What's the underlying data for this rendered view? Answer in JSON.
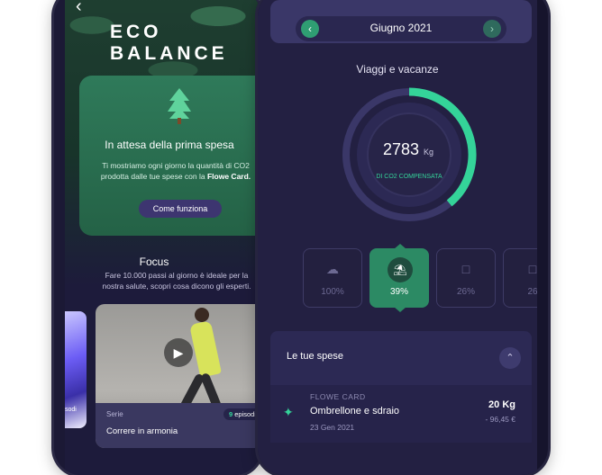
{
  "left_app": {
    "title": "ECO BALANCE",
    "card": {
      "title": "In attesa della prima spesa",
      "desc_prefix": "Ti mostriamo ogni giorno la quantità di CO2 prodotta dalle tue spese con la",
      "desc_bold": "Flowe Card.",
      "button": "Come funziona"
    },
    "focus": {
      "title": "Focus",
      "desc": "Fare 10.000 passi al giorno è ideale per la nostra salute, scopri cosa dicono gli esperti."
    },
    "side_thumb_label": "sodi",
    "video": {
      "series_label": "Serie",
      "episodes_count": "9",
      "episodes_label": "episodi",
      "title": "Correre in armonia"
    }
  },
  "right_app": {
    "month": "Giugno 2021",
    "category_title": "Viaggi e vacanze",
    "gauge": {
      "value": "2783",
      "unit": "Kg",
      "label": "DI CO2 COMPENSATA",
      "fill_fraction": 0.39
    },
    "tiles": [
      {
        "icon": "cloud-icon",
        "percent": "100%",
        "active": false
      },
      {
        "icon": "umbrella-icon",
        "percent": "39%",
        "active": true
      },
      {
        "icon": "shirt-icon",
        "percent": "26%",
        "active": false
      },
      {
        "icon": "bag-icon",
        "percent": "26",
        "active": false
      }
    ],
    "spese_title": "Le tue spese",
    "transaction": {
      "source": "FLOWE CARD",
      "name": "Ombrellone e sdraio",
      "date": "23 Gen 2021",
      "co2": "20 Kg",
      "amount": "- 96,45 €"
    }
  },
  "colors": {
    "accent_green": "#34d399",
    "card_green": "#2f7a5a",
    "background_dark": "#232042"
  }
}
